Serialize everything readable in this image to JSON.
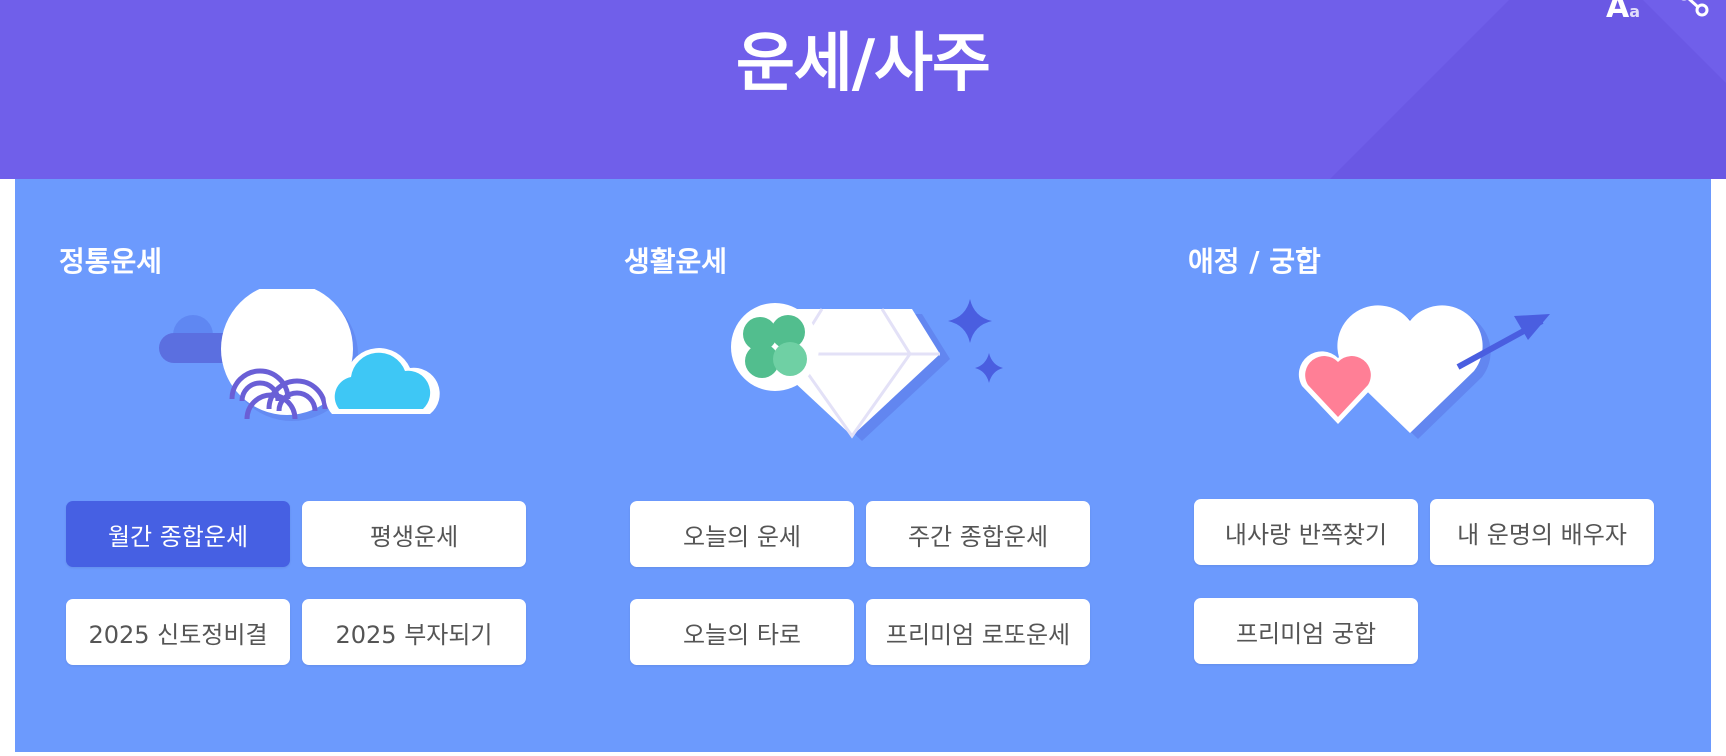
{
  "header": {
    "title": "운세/사주",
    "font_tool": {
      "big": "A",
      "small": "a"
    }
  },
  "sections": [
    {
      "title": "정통운세",
      "buttons": [
        "월간 종합운세",
        "평생운세",
        "2025 신토정비결",
        "2025 부자되기"
      ]
    },
    {
      "title": "생활운세",
      "buttons": [
        "오늘의 운세",
        "주간 종합운세",
        "오늘의 타로",
        "프리미엄 로또운세"
      ]
    },
    {
      "title": "애정 / 궁합",
      "buttons": [
        "내사랑 반쪽찾기",
        "내 운명의 배우자",
        "프리미엄 궁합"
      ]
    }
  ],
  "icons": {
    "font-size": "font-size-icon",
    "share": "share-icon",
    "section1": "moon-cloud-icon",
    "section2": "clover-diamond-icon",
    "section3": "hearts-arrow-icon"
  },
  "colors": {
    "header_bg": "#705fea",
    "panel_bg": "#6c9afd",
    "active_button": "#4660e3",
    "button_bg": "#ffffff",
    "button_text": "#555555"
  }
}
